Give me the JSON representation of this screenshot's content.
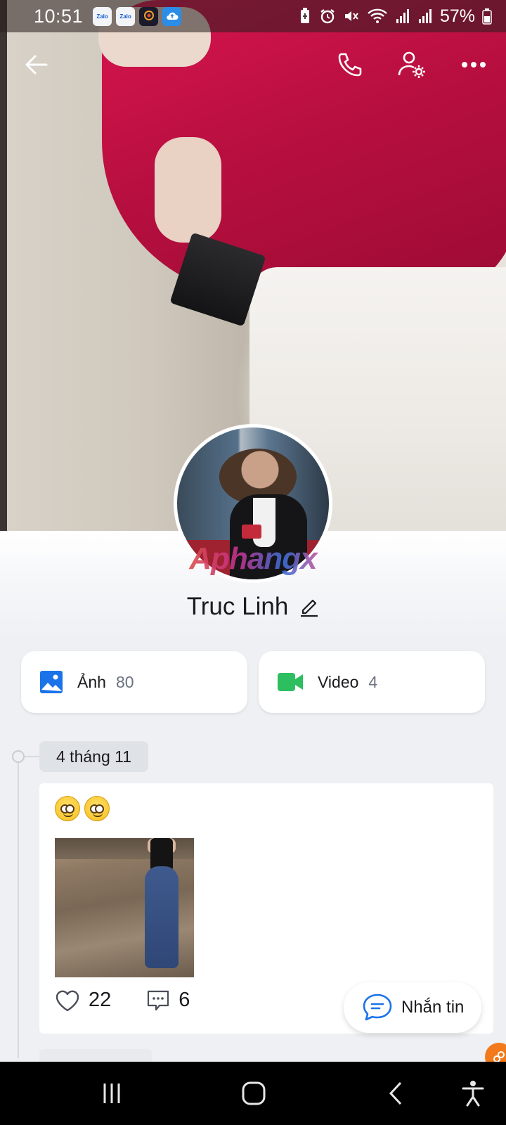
{
  "status_bar": {
    "time": "10:51",
    "app_icons": [
      {
        "name": "zalo-icon",
        "label": "Zalo"
      },
      {
        "name": "zalo-icon",
        "label": "Zalo"
      },
      {
        "name": "dream-app-icon",
        "label": "DREAM"
      },
      {
        "name": "cloud-upload-icon",
        "label": ""
      }
    ],
    "battery": "57%"
  },
  "top_nav": {
    "back_icon": "arrow-left-icon",
    "call_icon": "phone-icon",
    "settings_icon": "user-settings-icon",
    "more_icon": "more-horizontal-icon"
  },
  "profile": {
    "name": "Truc Linh",
    "watermark": "Aphangx"
  },
  "media": {
    "photos": {
      "label": "Ảnh",
      "count": "80",
      "icon": "image-icon",
      "color": "#1a73e8"
    },
    "videos": {
      "label": "Video",
      "count": "4",
      "icon": "video-camera-icon",
      "color": "#2dbe60"
    }
  },
  "timeline": {
    "date": "4 tháng 11",
    "post": {
      "emoji": [
        "🙄",
        "🙄"
      ],
      "likes": "22",
      "comments": "6"
    }
  },
  "fab": {
    "label": "Nhắn tin",
    "icon": "chat-bubble-icon",
    "color": "#1a73e8"
  },
  "colors": {
    "accent": "#1a73e8",
    "video": "#2dbe60",
    "background": "#eef0f3",
    "corner_badge": "#f27a1a"
  }
}
